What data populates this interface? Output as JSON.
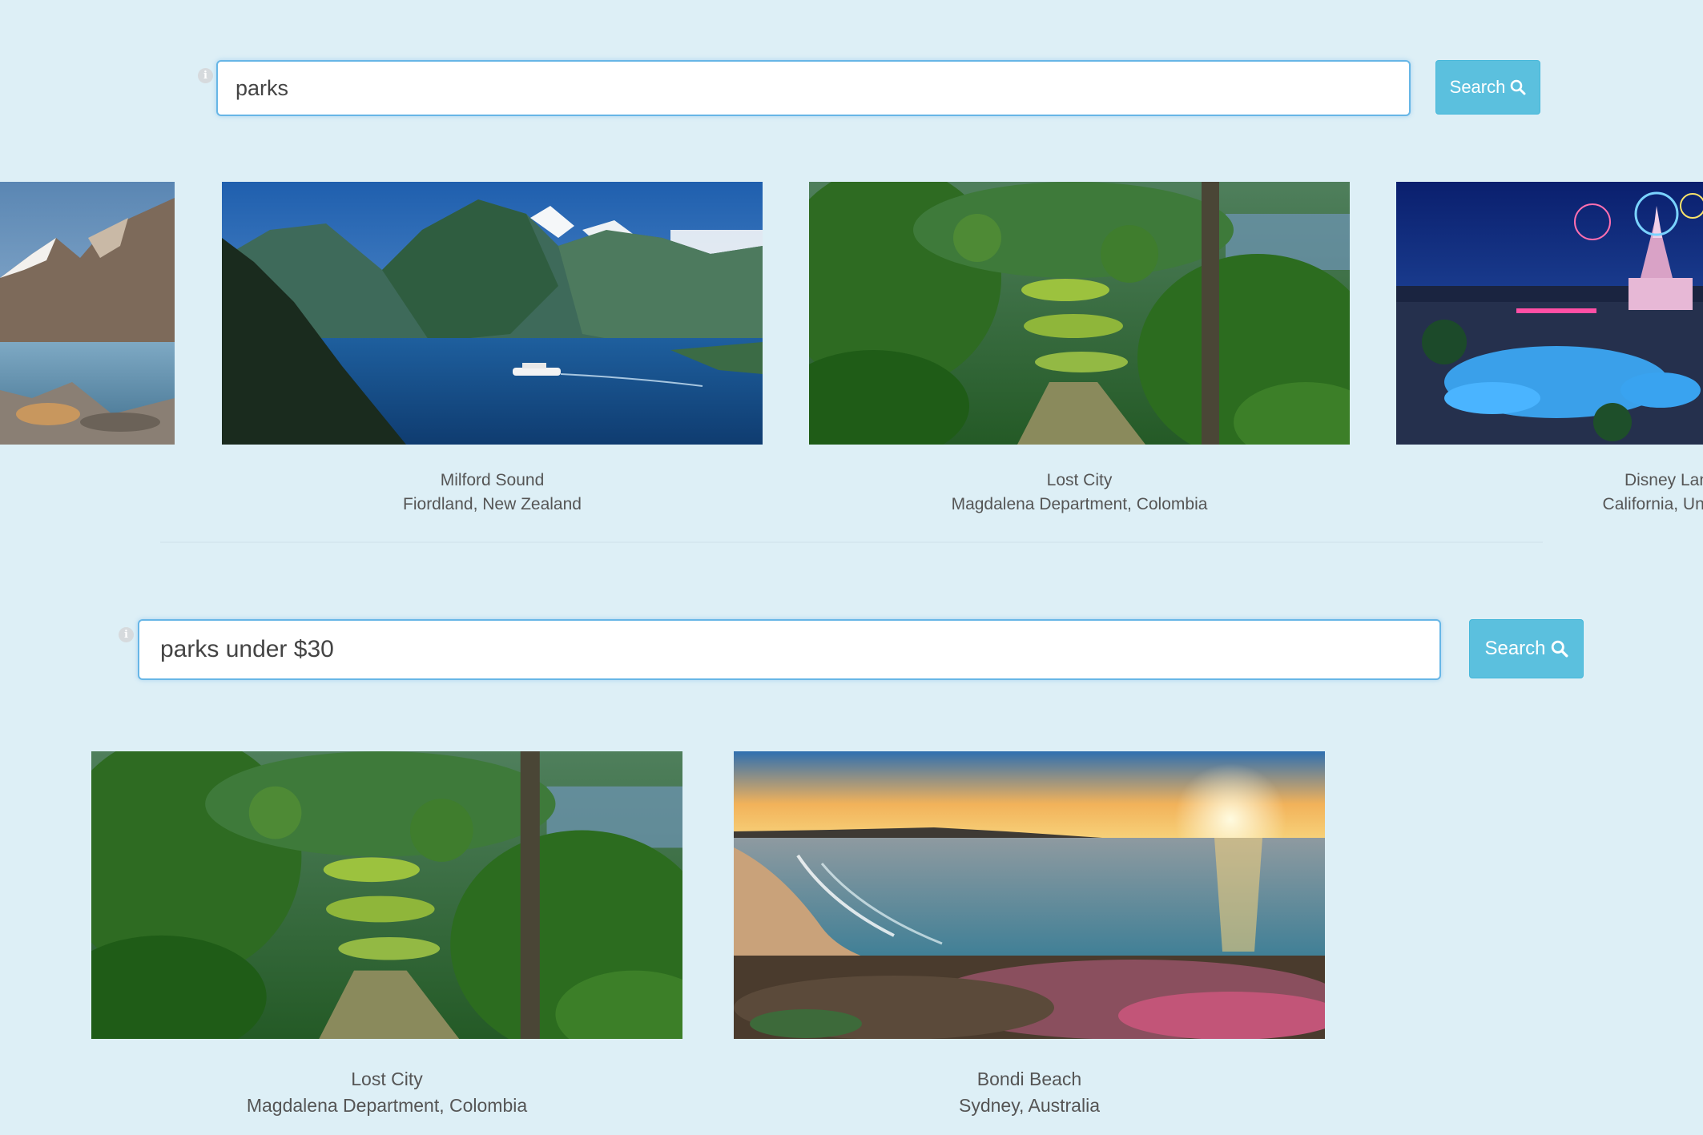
{
  "search1": {
    "query": "parks",
    "button_label": "Search"
  },
  "carousel1": [
    {
      "title": "",
      "subtitle": ""
    },
    {
      "title": "Milford Sound",
      "subtitle": "Fiordland, New Zealand"
    },
    {
      "title": "Lost City",
      "subtitle": "Magdalena Department, Colombia"
    },
    {
      "title": "Disney Lan",
      "subtitle": "California, Unitec"
    }
  ],
  "search2": {
    "query": "parks under $30",
    "button_label": "Search"
  },
  "results2": [
    {
      "title": "Lost City",
      "subtitle": "Magdalena Department, Colombia"
    },
    {
      "title": "Bondi Beach",
      "subtitle": "Sydney, Australia"
    }
  ],
  "colors": {
    "background": "#ddeff6",
    "button": "#5bc0de",
    "input_border": "#67b6e6"
  },
  "icons": {
    "info": "info-icon",
    "search": "magnifier-icon"
  }
}
